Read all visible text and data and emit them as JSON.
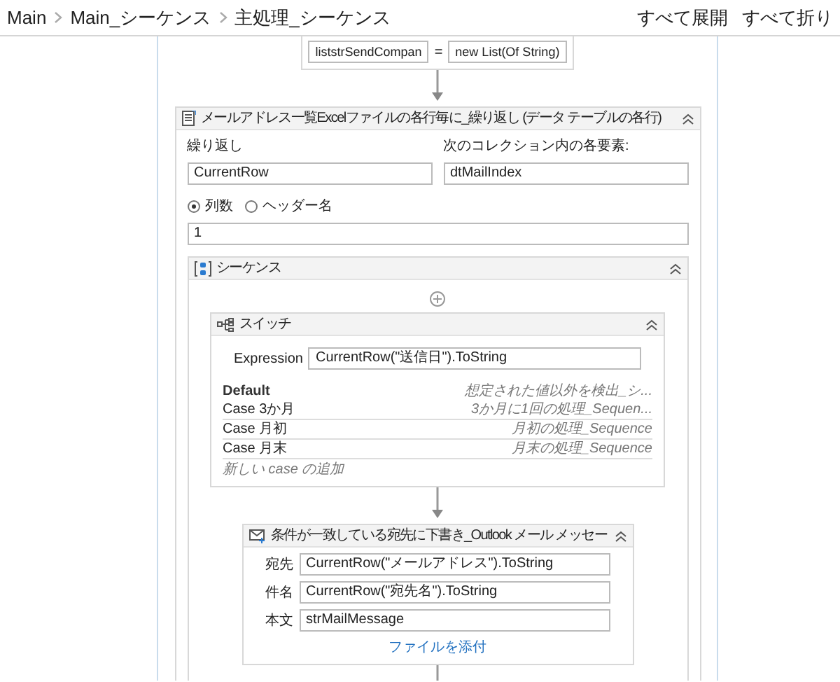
{
  "breadcrumb": [
    {
      "label": "Main"
    },
    {
      "label": "Main_シーケンス"
    },
    {
      "label": "主処理_シーケンス"
    }
  ],
  "toolbar": [
    "すべて展開",
    "すべて折り"
  ],
  "assign": {
    "to": "liststrSendCompan",
    "operator": "=",
    "value": "new List(Of String)"
  },
  "for_each": {
    "title": "メールアドレス一覧Excelファイルの各行毎に_繰り返し (データ テーブルの各行)",
    "item_label": "繰り返し",
    "item_value": "CurrentRow",
    "collection_label": "次のコレクション内の各要素:",
    "collection_value": "dtMailIndex",
    "options": [
      {
        "label": "列数",
        "selected": true
      },
      {
        "label": "ヘッダー名",
        "selected": false
      }
    ],
    "column_value": "1",
    "sequence": {
      "title": "シーケンス",
      "switch": {
        "title": "スイッチ",
        "expression_label": "Expression",
        "expression_value": "CurrentRow(\"送信日\").ToString",
        "cases": [
          {
            "kind": "default",
            "label": "Default",
            "body": "想定された値以外を検出_シ..."
          },
          {
            "kind": "case",
            "label": "Case  3か月",
            "body": "3か月に1回の処理_Sequen..."
          },
          {
            "kind": "case",
            "label": "Case  月初",
            "body": "月初の処理_Sequence"
          },
          {
            "kind": "case",
            "label": "Case  月末",
            "body": "月末の処理_Sequence"
          }
        ],
        "add_case": "新しい case の追加"
      },
      "mail": {
        "title": "条件が一致している宛先に下書き_Outlook メール メッセー",
        "fields": [
          {
            "label": "宛先",
            "value": "CurrentRow(\"メールアドレス\").ToString"
          },
          {
            "label": "件名",
            "value": "CurrentRow(\"宛先名\").ToString"
          },
          {
            "label": "本文",
            "value": "strMailMessage"
          }
        ],
        "attach": "ファイルを添付"
      }
    }
  }
}
